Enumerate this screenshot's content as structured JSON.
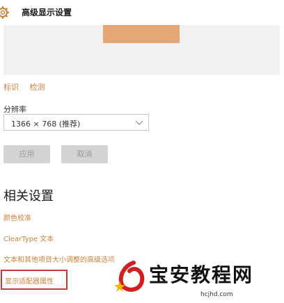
{
  "header": {
    "title": "高级显示设置",
    "icon": "gear-icon"
  },
  "preview": {
    "monitor_color": "#e6a673"
  },
  "display_links": {
    "identify": "标识",
    "detect": "检测"
  },
  "resolution": {
    "label": "分辨率",
    "value": "1366 × 768 (推荐)"
  },
  "buttons": {
    "apply": "应用",
    "cancel": "取消"
  },
  "related": {
    "title": "相关设置",
    "links": [
      "颜色校准",
      "ClearType 文本",
      "文本和其他项目大小调整的高级选项",
      "显示适配器属性"
    ]
  },
  "watermark": {
    "text": "宝安教程网",
    "url": "hcjhd.com"
  },
  "colors": {
    "accent": "#c8823b",
    "highlight_border": "#c83a3a"
  }
}
